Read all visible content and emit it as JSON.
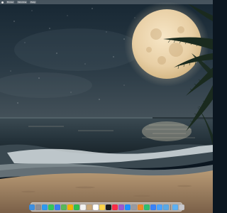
{
  "menubar": {
    "items": [
      "Finder",
      "Window",
      "Help"
    ]
  },
  "dock": {
    "apps": [
      {
        "icon": "finder-icon",
        "color": "#3d8fe0"
      },
      {
        "icon": "launchpad-icon",
        "color": "#8e8e93"
      },
      {
        "icon": "safari-icon",
        "color": "#2f9bf0"
      },
      {
        "icon": "messages-icon",
        "color": "#34c759"
      },
      {
        "icon": "mail-icon",
        "color": "#3a7ef0"
      },
      {
        "icon": "maps-icon",
        "color": "#58b85a"
      },
      {
        "icon": "photos-icon",
        "color": "#f4b400"
      },
      {
        "icon": "facetime-icon",
        "color": "#30c04f"
      },
      {
        "icon": "calendar-icon",
        "color": "#f2f2f2"
      },
      {
        "icon": "contacts-icon",
        "color": "#c9a77a"
      },
      {
        "icon": "reminders-icon",
        "color": "#ffffff"
      },
      {
        "icon": "notes-icon",
        "color": "#ffd54a"
      },
      {
        "icon": "tv-icon",
        "color": "#1c1c1e"
      },
      {
        "icon": "music-icon",
        "color": "#fa2d48"
      },
      {
        "icon": "podcasts-icon",
        "color": "#9b59d0"
      },
      {
        "icon": "app-store-icon",
        "color": "#1e90ff"
      },
      {
        "icon": "system-settings-icon",
        "color": "#9a9aa0"
      },
      {
        "icon": "pages-icon",
        "color": "#f08a24"
      },
      {
        "icon": "numbers-icon",
        "color": "#2fbf71"
      },
      {
        "icon": "keynote-icon",
        "color": "#3a82f7"
      },
      {
        "icon": "xcode-icon",
        "color": "#4aa3ff"
      },
      {
        "icon": "preview-icon",
        "color": "#5aa9e6"
      }
    ],
    "trailing": [
      {
        "icon": "downloads-folder-icon",
        "color": "#5db2f5"
      },
      {
        "icon": "trash-icon",
        "color": "#c8c8cc"
      }
    ]
  }
}
